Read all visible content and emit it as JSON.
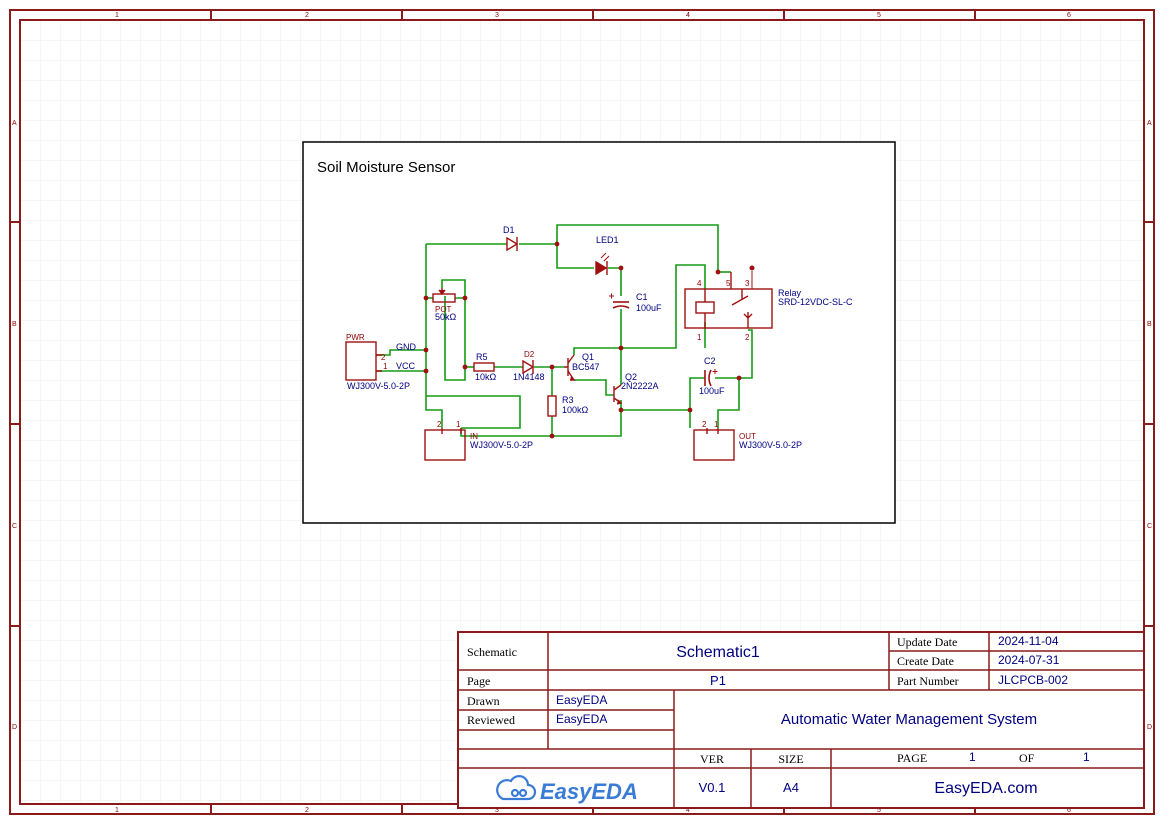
{
  "colors": {
    "border": "#8b1a1a",
    "wire": "#169c16",
    "component": "#a01010",
    "junction": "#a01010",
    "label": "#000080",
    "grid": "#e4e4e4"
  },
  "frame": {
    "columns": [
      "1",
      "2",
      "3",
      "4",
      "5",
      "6"
    ],
    "rows": [
      "A",
      "B",
      "C",
      "D"
    ]
  },
  "schematic": {
    "title": "Soil Moisture Sensor",
    "components": {
      "d1": {
        "ref": "D1"
      },
      "led1": {
        "ref": "LED1"
      },
      "pot": {
        "ref": "POT",
        "value": "50kΩ"
      },
      "c1": {
        "ref": "C1",
        "value": "100uF"
      },
      "relay": {
        "ref": "Relay",
        "value": "SRD-12VDC-SL-C",
        "pins": [
          "4",
          "5",
          "3",
          "1",
          "2"
        ]
      },
      "pwr": {
        "ref": "PWR",
        "value": "WJ300V-5.0-2P",
        "pins": [
          "2",
          "1"
        ]
      },
      "r5": {
        "ref": "R5",
        "value": "10kΩ"
      },
      "d2": {
        "ref": "D2",
        "value": "1N4148"
      },
      "q1": {
        "ref": "Q1",
        "value": "BC547"
      },
      "q2": {
        "ref": "Q2",
        "value": "2N2222A"
      },
      "c2": {
        "ref": "C2",
        "value": "100uF"
      },
      "r3": {
        "ref": "R3",
        "value": "100kΩ"
      },
      "in": {
        "ref": "IN",
        "value": "WJ300V-5.0-2P",
        "pins": [
          "2",
          "1"
        ]
      },
      "out": {
        "ref": "OUT",
        "value": "WJ300V-5.0-2P",
        "pins": [
          "2",
          "1"
        ]
      }
    },
    "nets": {
      "gnd": "GND",
      "vcc": "VCC"
    }
  },
  "title_block": {
    "schematic_label": "Schematic",
    "schematic_value": "Schematic1",
    "page_label": "Page",
    "page_value": "P1",
    "update_date_label": "Update Date",
    "update_date": "2024-11-04",
    "create_date_label": "Create Date",
    "create_date": "2024-07-31",
    "part_number_label": "Part Number",
    "part_number": "JLCPCB-002",
    "drawn_label": "Drawn",
    "drawn_value": "EasyEDA",
    "reviewed_label": "Reviewed",
    "reviewed_value": "EasyEDA",
    "project_title": "Automatic Water Management System",
    "ver_label": "VER",
    "ver_value": "V0.1",
    "size_label": "SIZE",
    "size_value": "A4",
    "page_no_label": "PAGE",
    "page_no": "1",
    "of_label": "OF",
    "of_value": "1",
    "logo_text": "EasyEDA",
    "website": "EasyEDA.com"
  }
}
